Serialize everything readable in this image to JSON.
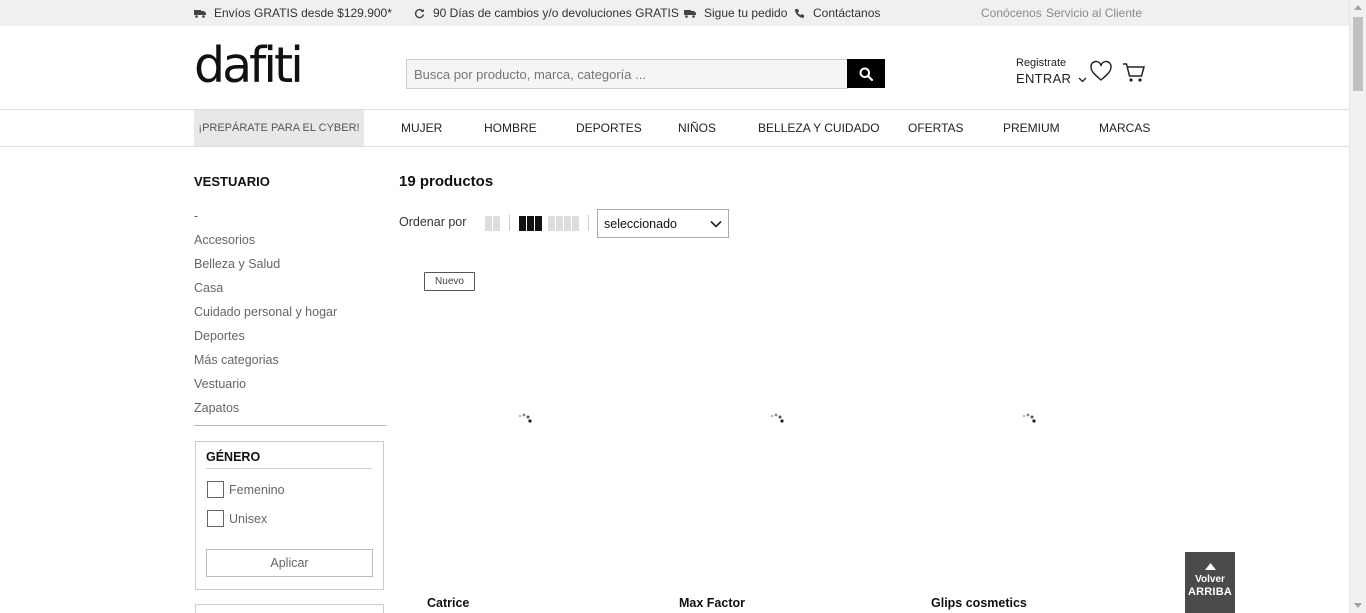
{
  "topbar": {
    "shipping": "Envíos GRATIS desde $129.900*",
    "returns": "90 Días de cambios y/o devoluciones GRATIS",
    "track": "Sigue tu pedido",
    "contact": "Contáctanos",
    "about": "Conócenos",
    "service": "Servicio al Cliente"
  },
  "header": {
    "logo": "dafiti",
    "search_placeholder": "Busca por producto, marca, categoría ...",
    "register": "Registrate",
    "login": "ENTRAR"
  },
  "nav": {
    "promo": "¡PREPÁRATE PARA EL CYBER!",
    "items": [
      "MUJER",
      "HOMBRE",
      "DEPORTES",
      "NIÑOS",
      "BELLEZA Y CUIDADO",
      "OFERTAS",
      "PREMIUM",
      "MARCAS"
    ]
  },
  "sidebar": {
    "title": "VESTUARIO",
    "categories": [
      "-",
      "Accesorios",
      "Belleza y Salud",
      "Casa",
      "Cuidado personal y hogar",
      "Deportes",
      "Más categorias",
      "Vestuario",
      "Zapatos"
    ],
    "filter": {
      "title": "GÉNERO",
      "options": [
        "Femenino",
        "Unisex"
      ],
      "apply": "Aplicar"
    }
  },
  "main": {
    "count": "19 productos",
    "sort_label": "Ordenar por",
    "sort_value": "seleccionado",
    "badge": "Nuevo",
    "brands": [
      "Catrice",
      "Max Factor",
      "Glips cosmetics"
    ]
  },
  "back_to_top": {
    "line1": "Volver",
    "line2": "ARRIBA"
  },
  "colors": {
    "topbar_bg": "#f0f0f0",
    "search_button": "#000000",
    "back_to_top_bg": "#4a4a4a"
  }
}
